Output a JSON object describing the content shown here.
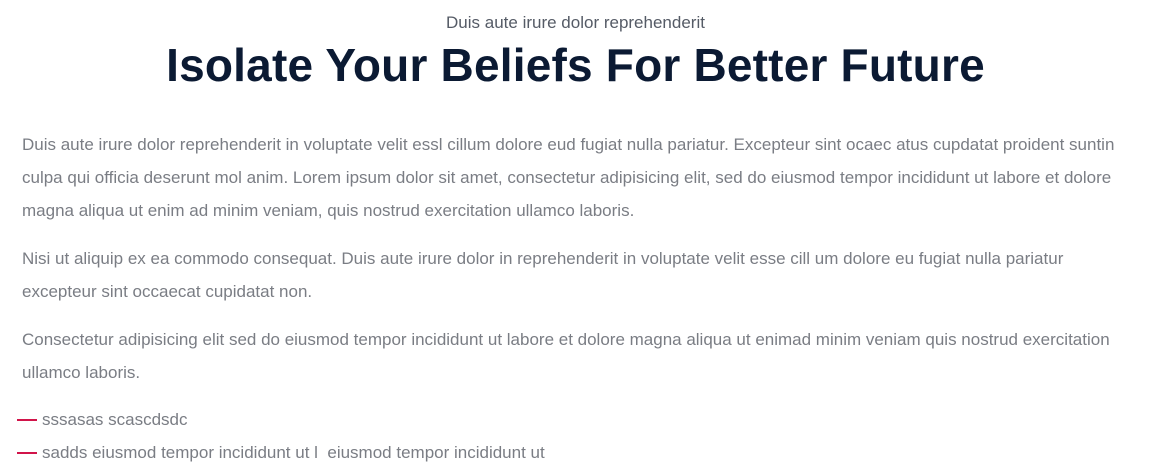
{
  "header": {
    "eyebrow": "Duis aute irure dolor reprehenderit",
    "title": "Isolate Your Beliefs For Better Future"
  },
  "paragraphs": [
    "Duis aute irure dolor reprehenderit in voluptate velit essl cillum dolore eud fugiat nulla pariatur. Excepteur sint ocaec atus cupdatat proident suntin culpa qui officia deserunt mol anim. Lorem ipsum dolor sit amet, consectetur adipisicing elit, sed do eiusmod tempor incididunt ut labore et dolore magna aliqua ut enim ad minim veniam, quis nostrud exercitation ullamco laboris.",
    "Nisi ut aliquip ex ea commodo consequat. Duis aute irure dolor in reprehenderit in voluptate velit esse cill um dolore eu fugiat nulla pariatur excepteur sint occaecat cupidatat non.",
    "Consectetur adipisicing elit sed do eiusmod tempor incididunt ut labore et dolore magna aliqua ut enimad minim veniam quis nostrud exercitation ullamco laboris."
  ],
  "list": {
    "items": [
      "sssasas scascdsdc",
      "sadds eiusmod tempor incididunt ut l  eiusmod tempor incididunt ut"
    ]
  },
  "colors": {
    "title": "#0b1a33",
    "body_text": "#7a7d84",
    "accent_dash": "#d1144a",
    "background": "#ffffff"
  }
}
